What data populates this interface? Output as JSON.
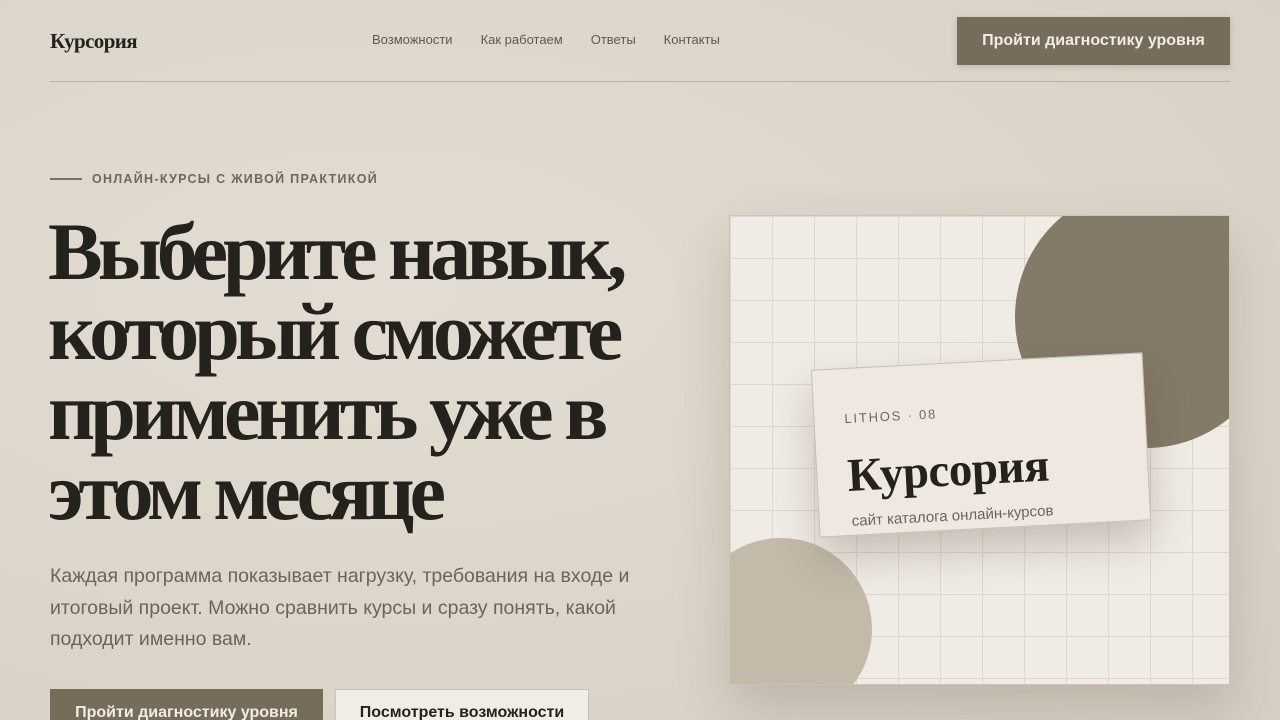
{
  "header": {
    "logo": "Курсория",
    "nav": [
      "Возможности",
      "Как работаем",
      "Ответы",
      "Контакты"
    ],
    "cta_label": "Пройти диагностику уровня"
  },
  "hero": {
    "eyebrow": "ОНЛАЙН-КУРСЫ С ЖИВОЙ ПРАКТИКОЙ",
    "headline": "Выберите навык, который сможете применить уже в этом месяце",
    "lead": "Каждая программа показывает нагрузку, требования на входе и итоговый проект. Можно сравнить курсы и сразу понять, какой подходит именно вам.",
    "primary_label": "Пройти диагностику уровня",
    "secondary_label": "Посмотреть возможности"
  },
  "card": {
    "tag": "LITHOS · 08",
    "title": "Курсория",
    "subtitle": "сайт каталога онлайн-курсов"
  },
  "colors": {
    "accent": "#766c5a",
    "text": "#24221d",
    "background": "#ddd6cb"
  }
}
